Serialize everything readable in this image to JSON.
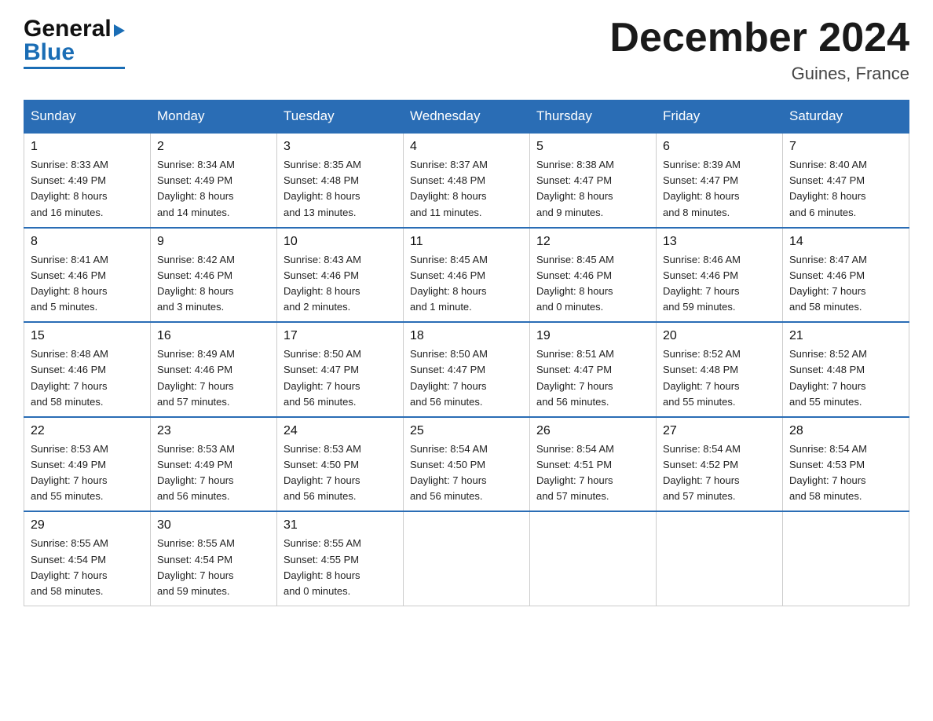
{
  "header": {
    "logo_general": "General",
    "logo_blue": "Blue",
    "month_title": "December 2024",
    "location": "Guines, France"
  },
  "weekdays": [
    "Sunday",
    "Monday",
    "Tuesday",
    "Wednesday",
    "Thursday",
    "Friday",
    "Saturday"
  ],
  "weeks": [
    [
      {
        "day": "1",
        "info": "Sunrise: 8:33 AM\nSunset: 4:49 PM\nDaylight: 8 hours\nand 16 minutes."
      },
      {
        "day": "2",
        "info": "Sunrise: 8:34 AM\nSunset: 4:49 PM\nDaylight: 8 hours\nand 14 minutes."
      },
      {
        "day": "3",
        "info": "Sunrise: 8:35 AM\nSunset: 4:48 PM\nDaylight: 8 hours\nand 13 minutes."
      },
      {
        "day": "4",
        "info": "Sunrise: 8:37 AM\nSunset: 4:48 PM\nDaylight: 8 hours\nand 11 minutes."
      },
      {
        "day": "5",
        "info": "Sunrise: 8:38 AM\nSunset: 4:47 PM\nDaylight: 8 hours\nand 9 minutes."
      },
      {
        "day": "6",
        "info": "Sunrise: 8:39 AM\nSunset: 4:47 PM\nDaylight: 8 hours\nand 8 minutes."
      },
      {
        "day": "7",
        "info": "Sunrise: 8:40 AM\nSunset: 4:47 PM\nDaylight: 8 hours\nand 6 minutes."
      }
    ],
    [
      {
        "day": "8",
        "info": "Sunrise: 8:41 AM\nSunset: 4:46 PM\nDaylight: 8 hours\nand 5 minutes."
      },
      {
        "day": "9",
        "info": "Sunrise: 8:42 AM\nSunset: 4:46 PM\nDaylight: 8 hours\nand 3 minutes."
      },
      {
        "day": "10",
        "info": "Sunrise: 8:43 AM\nSunset: 4:46 PM\nDaylight: 8 hours\nand 2 minutes."
      },
      {
        "day": "11",
        "info": "Sunrise: 8:45 AM\nSunset: 4:46 PM\nDaylight: 8 hours\nand 1 minute."
      },
      {
        "day": "12",
        "info": "Sunrise: 8:45 AM\nSunset: 4:46 PM\nDaylight: 8 hours\nand 0 minutes."
      },
      {
        "day": "13",
        "info": "Sunrise: 8:46 AM\nSunset: 4:46 PM\nDaylight: 7 hours\nand 59 minutes."
      },
      {
        "day": "14",
        "info": "Sunrise: 8:47 AM\nSunset: 4:46 PM\nDaylight: 7 hours\nand 58 minutes."
      }
    ],
    [
      {
        "day": "15",
        "info": "Sunrise: 8:48 AM\nSunset: 4:46 PM\nDaylight: 7 hours\nand 58 minutes."
      },
      {
        "day": "16",
        "info": "Sunrise: 8:49 AM\nSunset: 4:46 PM\nDaylight: 7 hours\nand 57 minutes."
      },
      {
        "day": "17",
        "info": "Sunrise: 8:50 AM\nSunset: 4:47 PM\nDaylight: 7 hours\nand 56 minutes."
      },
      {
        "day": "18",
        "info": "Sunrise: 8:50 AM\nSunset: 4:47 PM\nDaylight: 7 hours\nand 56 minutes."
      },
      {
        "day": "19",
        "info": "Sunrise: 8:51 AM\nSunset: 4:47 PM\nDaylight: 7 hours\nand 56 minutes."
      },
      {
        "day": "20",
        "info": "Sunrise: 8:52 AM\nSunset: 4:48 PM\nDaylight: 7 hours\nand 55 minutes."
      },
      {
        "day": "21",
        "info": "Sunrise: 8:52 AM\nSunset: 4:48 PM\nDaylight: 7 hours\nand 55 minutes."
      }
    ],
    [
      {
        "day": "22",
        "info": "Sunrise: 8:53 AM\nSunset: 4:49 PM\nDaylight: 7 hours\nand 55 minutes."
      },
      {
        "day": "23",
        "info": "Sunrise: 8:53 AM\nSunset: 4:49 PM\nDaylight: 7 hours\nand 56 minutes."
      },
      {
        "day": "24",
        "info": "Sunrise: 8:53 AM\nSunset: 4:50 PM\nDaylight: 7 hours\nand 56 minutes."
      },
      {
        "day": "25",
        "info": "Sunrise: 8:54 AM\nSunset: 4:50 PM\nDaylight: 7 hours\nand 56 minutes."
      },
      {
        "day": "26",
        "info": "Sunrise: 8:54 AM\nSunset: 4:51 PM\nDaylight: 7 hours\nand 57 minutes."
      },
      {
        "day": "27",
        "info": "Sunrise: 8:54 AM\nSunset: 4:52 PM\nDaylight: 7 hours\nand 57 minutes."
      },
      {
        "day": "28",
        "info": "Sunrise: 8:54 AM\nSunset: 4:53 PM\nDaylight: 7 hours\nand 58 minutes."
      }
    ],
    [
      {
        "day": "29",
        "info": "Sunrise: 8:55 AM\nSunset: 4:54 PM\nDaylight: 7 hours\nand 58 minutes."
      },
      {
        "day": "30",
        "info": "Sunrise: 8:55 AM\nSunset: 4:54 PM\nDaylight: 7 hours\nand 59 minutes."
      },
      {
        "day": "31",
        "info": "Sunrise: 8:55 AM\nSunset: 4:55 PM\nDaylight: 8 hours\nand 0 minutes."
      },
      {
        "day": "",
        "info": ""
      },
      {
        "day": "",
        "info": ""
      },
      {
        "day": "",
        "info": ""
      },
      {
        "day": "",
        "info": ""
      }
    ]
  ]
}
